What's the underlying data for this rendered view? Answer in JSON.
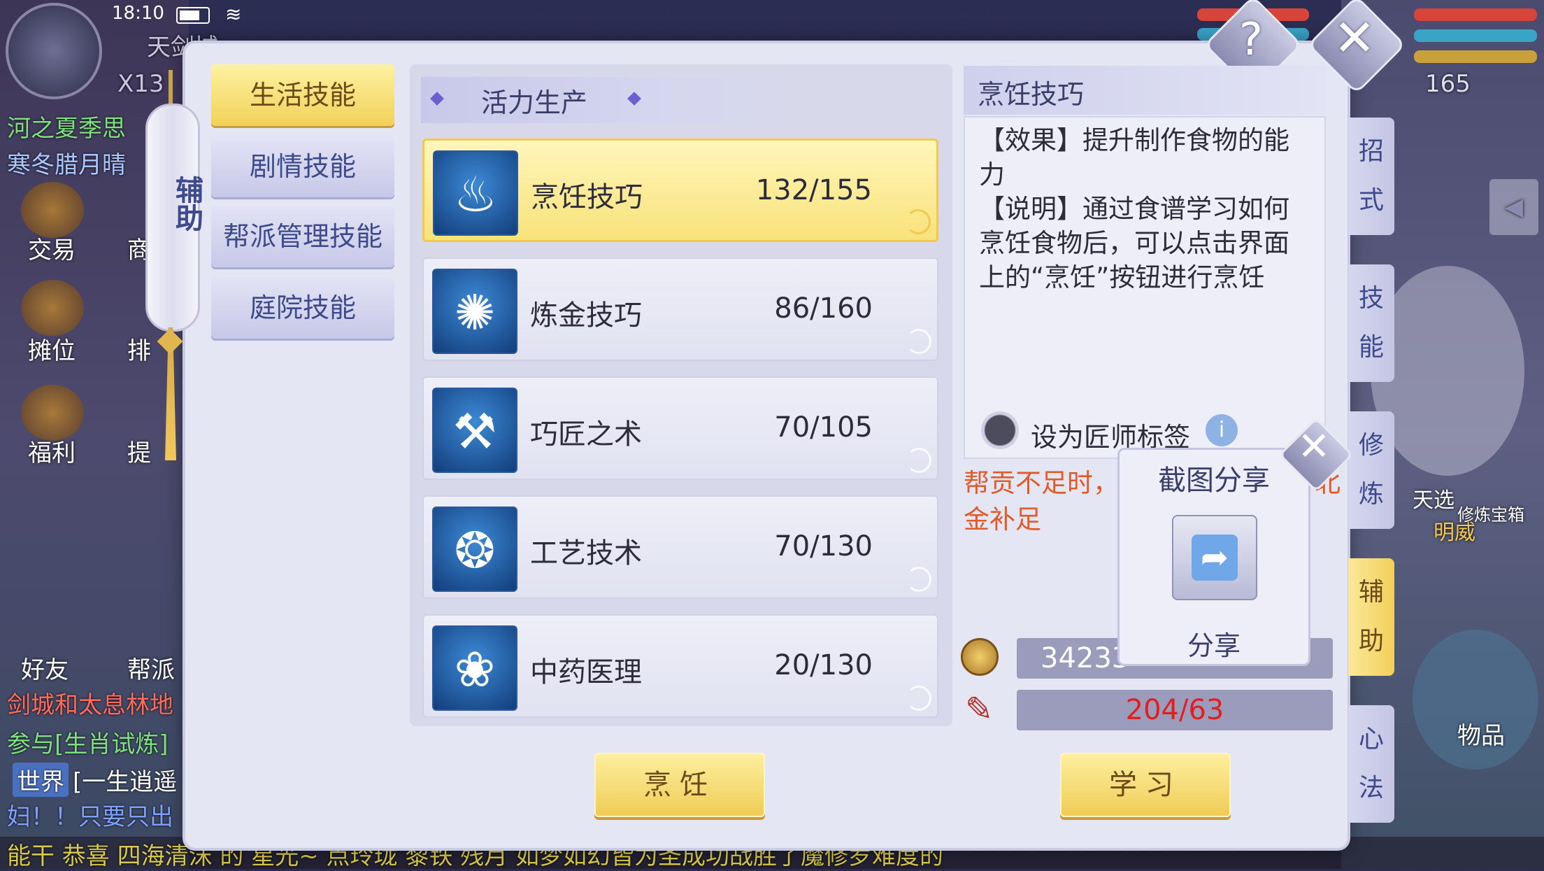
{
  "status": {
    "time": "18:10"
  },
  "hud": {
    "level": "165",
    "side_buttons": [
      "交易",
      "摊位",
      "福利",
      "好友",
      "帮派"
    ],
    "side_buttons_right": [
      "物品"
    ],
    "clipped_buttons": [
      "商",
      "排",
      "提"
    ],
    "chat": [
      "河之夏季思",
      "寒冬腊月晴",
      "剑城和太息林地",
      "参与[生肖试炼]",
      "[一生逍遥",
      "妇！！只要只出"
    ],
    "chat_channel": "世界",
    "ticker": "能干 恭喜 四海清沫 的 星光~ 点玲珑 黎铁 残月 如梦如幻皆为圣成功战胜了魔修罗难度的",
    "scene_labels": [
      "天剑城",
      "天选",
      "明威",
      "修炼宝箱"
    ],
    "multiplier": "X13"
  },
  "scroll": {
    "label": "辅助"
  },
  "left_tabs": [
    {
      "label": "生活技能",
      "active": true
    },
    {
      "label": "剧情技能",
      "active": false
    },
    {
      "label": "帮派管理技能",
      "active": false
    },
    {
      "label": "庭院技能",
      "active": false
    }
  ],
  "list": {
    "header": "活力生产",
    "skills": [
      {
        "name": "烹饪技巧",
        "value": "132/155",
        "icon": "cooking-pot-icon",
        "glyph": "♨",
        "active": true
      },
      {
        "name": "炼金技巧",
        "value": "86/160",
        "icon": "alchemy-icon",
        "glyph": "✺",
        "active": false
      },
      {
        "name": "巧匠之术",
        "value": "70/105",
        "icon": "axe-hammer-icon",
        "glyph": "⚒",
        "active": false
      },
      {
        "name": "工艺技术",
        "value": "70/130",
        "icon": "beads-icon",
        "glyph": "❂",
        "active": false
      },
      {
        "name": "中药医理",
        "value": "20/130",
        "icon": "lotus-icon",
        "glyph": "❀",
        "active": false
      }
    ]
  },
  "detail": {
    "title": "烹饪技巧",
    "effect": "【效果】提升制作食物的能力",
    "note": "【说明】通过食谱学习如何烹饪食物后，可以点击界面上的“烹饪”按钮进行烹饪",
    "checkbox_label": "设为匠师标签",
    "warning_line1": "帮贡不足时，",
    "warning_line2": "金补足",
    "warning_tail": "北",
    "money": "34233",
    "vitality": "204/63"
  },
  "buttons": {
    "cook": "烹饪",
    "learn": "学习"
  },
  "right_tabs": [
    {
      "label": [
        "招",
        "式"
      ],
      "active": false
    },
    {
      "label": [
        "技",
        "能"
      ],
      "active": false
    },
    {
      "label": [
        "修",
        "炼"
      ],
      "active": false
    },
    {
      "label": [
        "辅",
        "助"
      ],
      "active": true
    },
    {
      "label": [
        "心",
        "法"
      ],
      "active": false
    }
  ],
  "share": {
    "title": "截图分享",
    "label": "分享"
  },
  "top_buttons": {
    "help": "?",
    "close": "✕"
  },
  "colors": {
    "accent_gold": "#f2d158",
    "panel_bg": "#e5e6f3",
    "warning": "#e05a2a",
    "vitality_red": "#e02020"
  }
}
